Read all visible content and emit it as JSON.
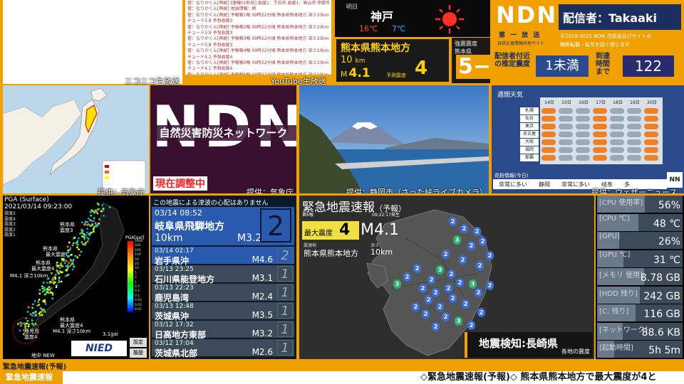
{
  "niconico_caption": "ニコニコ生放送",
  "youtube_caption": "YouTube生放送",
  "comments": [
    "管：なりかくん[再配]  [速報01秒前] 震度1：下呂市 震度1：高山市 伊那市市 御上市",
    "管：なりかくん[再配]  地震情報：終",
    "管：なりかくん[再配]  予報報1報 09時22分頃 熊本県熊本地方 深さ10km マグニ",
    "チュード3.8 予想震度3",
    "管：なりかくん[再配]  予報報2報 09時22分頃 熊本県熊本地方 深さ10km マグニ",
    "チュード3.9 予想震度3",
    "管：なりかくん[再配]  予報報3報 09時22分頃 熊本県熊本地方 深さ10km マグニ",
    "チュード3.8 予想震度3",
    "管：なりかくん[再配]  予報報4報 09時22分頃 熊本県熊本地方 深さ10km マグニ",
    "チュード4.2 予想震度4",
    "管：なりかくん[再配]  予報報5報 09時22分頃 熊本県熊本地方 深さ10km マグニ",
    "チュード4.1 予想震度4",
    "管：なりかくん[再配]  予報報6報 09時22分頃 熊本県熊本地方 深さ10km マグニ",
    "チュード4.1 予想震度4"
  ],
  "weather": {
    "day": "明日",
    "city": "神戸",
    "high": "16℃",
    "low": "7℃",
    "icon": "sun-icon"
  },
  "quake": {
    "region": "熊本県熊本地方",
    "depth_value": "10",
    "depth_unit": "km",
    "mag_prefix": "M",
    "magnitude": "4.1",
    "intensity_label": "予測震度",
    "intensity": "4"
  },
  "shindo_box": {
    "label": "強震震度",
    "place": "熊本県",
    "value": "5−"
  },
  "ndn": {
    "logo": "NDN",
    "distributor": "配信者：Takaaki",
    "sub1": "第 一 放 送",
    "sub2": "自然災害情報共有サイト",
    "copyright": "©2019-2021 NDN 当放送及びサイトの",
    "copyright2": "無断転載・転写を固く禁じます",
    "est_label": "配信者付近の推定震度",
    "est_value": "1未満",
    "arrival_label": "到達時間まで",
    "arrival_value": "122"
  },
  "map_caption": "提供：気象庁",
  "logo_panel": {
    "big": "NDN",
    "tagline": "自然災害防災ネットワーク",
    "status": "現在調整中",
    "caption": "提供：気象庁"
  },
  "fuji_caption": "提供：静岡市（さった峠ライブカメラ）",
  "weekly": {
    "title": "週間天気",
    "days": [
      "14日",
      "15日",
      "16日",
      "17日",
      "18日",
      "19日",
      "20日"
    ],
    "cities": [
      "札幌",
      "仙台",
      "東京",
      "名古屋",
      "大阪",
      "福岡",
      "那覇"
    ],
    "pollen_title": "花粉情報(今日)",
    "pollen": [
      "非常に多い",
      "静岡",
      "非常に多い",
      "岐阜",
      "多"
    ],
    "caption": "提供：ウェザーニュース",
    "badge": "NN"
  },
  "pga": {
    "title": "PGA (Surface)",
    "timestamp": "2021/03/14 09:23:00",
    "legend": [
      "震度5",
      "震度4",
      "震度3",
      "震度2",
      "震度1"
    ],
    "scale_title": "PGA[gal]",
    "scale": [
      "1000",
      "500",
      "200",
      "100",
      "50",
      "20",
      "10",
      "5",
      "2",
      "1",
      "0.5",
      "0.2",
      "0.1",
      "0.05",
      "0.02",
      "0.01"
    ],
    "labels": [
      "熊本県",
      "震度3",
      "熊本県",
      "最大震度",
      "熊本県",
      "最大震度4",
      "M4.1 深さ10km",
      "鹿児島",
      "震度4",
      "熊本県",
      "最大震度4",
      "M4.1 深さ10km"
    ],
    "small": "3.1gal",
    "logo": "NIED",
    "btn_set": "設定",
    "btn_hist": "履歴",
    "hint": "地中 NEW"
  },
  "tsunami": {
    "notice": "この地震による津波の心配はありません",
    "latest": {
      "time": "03/14 08:52",
      "place": "岐阜県飛騨地方",
      "depth": "10km",
      "mag": "M3.2",
      "int": "2"
    },
    "rows": [
      {
        "time": "03/14 02:17",
        "place": "岩手県沖",
        "mag": "M4.6",
        "int": "2"
      },
      {
        "time": "03/13 23:25",
        "place": "石川県能登地方",
        "mag": "M3.1",
        "int": "1"
      },
      {
        "time": "03/13 22:23",
        "place": "鹿児島湾",
        "mag": "M2.4",
        "int": "1"
      },
      {
        "time": "03/13 12:48",
        "place": "茨城県沖",
        "mag": "M3.5",
        "int": "1"
      },
      {
        "time": "03/12 17:32",
        "place": "日高地方東部",
        "mag": "M3.2",
        "int": "1"
      },
      {
        "time": "03/12 17:04",
        "place": "茨城県北部",
        "mag": "M2.6",
        "int": "1"
      }
    ]
  },
  "eew": {
    "title": "緊急地震速報",
    "type": "（予報）",
    "report": "第6報",
    "issued": "09:22:17発生",
    "max_label": "最大震度",
    "max_int": "4",
    "mag": "M4.1",
    "epi_label": "震源地",
    "epi": "熊本県熊本地方",
    "depth_label": "深さ",
    "depth": "10km",
    "detect": "地震検知:長崎県",
    "detect_sub": "各地の震度"
  },
  "stats": [
    {
      "label": "[CPU 使用率]",
      "value": "56%",
      "level": 0.56
    },
    {
      "label": "[CPU ℃]",
      "value": "48 ℃",
      "level": 0.48
    },
    {
      "label": "[GPU]",
      "value": "26%",
      "level": 0.26
    },
    {
      "label": "[GPU ℃]",
      "value": "31 ℃",
      "level": 0.31
    },
    {
      "label": "[メモリ 使用]",
      "value": "8.78 GB",
      "level": 0.55
    },
    {
      "label": "[HDD 残り]",
      "value": "242 GB",
      "level": 0.5
    },
    {
      "label": "[C: 残り]",
      "value": "116 GB",
      "level": 0.45
    },
    {
      "label": "[ネットワーク]",
      "value": "88.6 KB",
      "level": 0.3
    },
    {
      "label": "[起動時間]",
      "value": "5h 5m",
      "level": 0.2
    }
  ],
  "bottom": {
    "top_label": "緊急地震速報(予報)",
    "tag": "緊急地震速報",
    "ticker": "◇緊急地震速報(予報)◇ 熊本県熊本地方で最大震度が4と"
  }
}
